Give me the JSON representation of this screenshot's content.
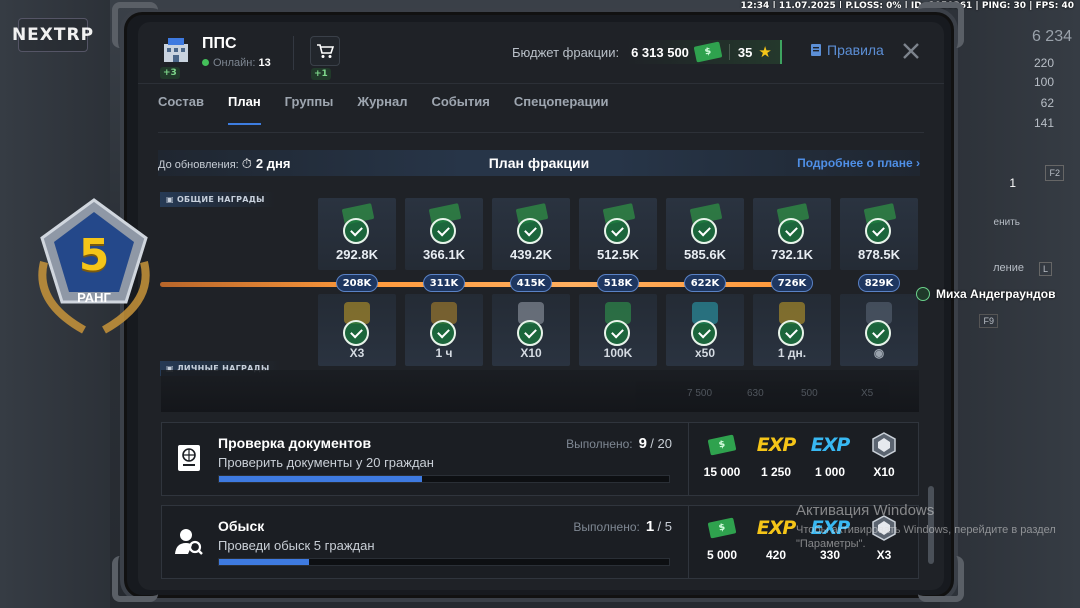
{
  "status_bar": "12:34 | 11.07.2025 | P.LOSS: 0% | ID: 1050361 | PING: 30 | FPS: 40",
  "logo_text": "NEXTRP",
  "hud": {
    "money_partial": "6 234",
    "stats": [
      "220",
      "100",
      "62",
      "141"
    ],
    "right_count": "1",
    "key_f2": "F2",
    "key_f9": "F9",
    "partial_action": "енить",
    "partial_manage": "ление",
    "key_l": "L"
  },
  "header": {
    "faction_name": "ППС",
    "hq_badge": "+3",
    "online_label": "Онлайн:",
    "online_count": "13",
    "shop_badge": "+1",
    "budget_label": "Бюджет фракции:",
    "budget_value": "6 313 500",
    "stars_value": "35",
    "rules_label": "Правила"
  },
  "tabs": [
    "Состав",
    "План",
    "Группы",
    "Журнал",
    "События",
    "Спецоперации"
  ],
  "active_tab": "План",
  "plan": {
    "update_label": "До обновления:",
    "update_value": "2 дня",
    "title": "План фракции",
    "more_link": "Подробнее о плане",
    "shared_rewards_label": "ОБЩИЕ НАГРАДЫ",
    "personal_rewards_label": "ЛИЧНЫЕ НАГРАДЫ",
    "rank_number": "5",
    "rank_label": "РАНГ",
    "shared_rewards": [
      "292.8K",
      "366.1K",
      "439.2K",
      "512.5K",
      "585.6K",
      "732.1K",
      "878.5K"
    ],
    "thresholds": [
      "208K",
      "311K",
      "415K",
      "518K",
      "622K",
      "726K",
      "829K"
    ],
    "personal_rewards": [
      "X3",
      "1 ч",
      "X10",
      "100K",
      "x50",
      "1 дн.",
      ""
    ],
    "member_name": "Миха Андеграундов",
    "ghost_values": [
      "7 500",
      "630",
      "500",
      "X5"
    ]
  },
  "quests": [
    {
      "title": "Проверка документов",
      "description": "Проверить документы у 20 граждан",
      "done_label": "Выполнено:",
      "done_current": "9",
      "done_total": "20",
      "progress": 0.45,
      "rewards": [
        {
          "icon": "cash-icon",
          "value": "15 000"
        },
        {
          "icon": "exp-gold-icon",
          "label": "EXP",
          "value": "1 250"
        },
        {
          "icon": "exp-blue-icon",
          "label": "EXP",
          "value": "1 000"
        },
        {
          "icon": "crate-icon",
          "value": "X10"
        }
      ]
    },
    {
      "title": "Обыск",
      "description": "Проведи обыск 5 граждан",
      "done_label": "Выполнено:",
      "done_current": "1",
      "done_total": "5",
      "progress": 0.2,
      "rewards": [
        {
          "icon": "cash-icon",
          "value": "5 000"
        },
        {
          "icon": "exp-gold-icon",
          "label": "EXP",
          "value": "420"
        },
        {
          "icon": "exp-blue-icon",
          "label": "EXP",
          "value": "330"
        },
        {
          "icon": "crate-icon",
          "value": "X3"
        }
      ]
    }
  ],
  "watermark": {
    "title": "Активация Windows",
    "subtitle": "Чтобы активировать Windows, перейдите в раздел \"Параметры\"."
  },
  "colors": {
    "accent": "#3d7de0",
    "money": "#2fa24e",
    "track": "#ff9a3c",
    "exp_gold": "#f5c518",
    "exp_blue": "#38b8f2"
  }
}
